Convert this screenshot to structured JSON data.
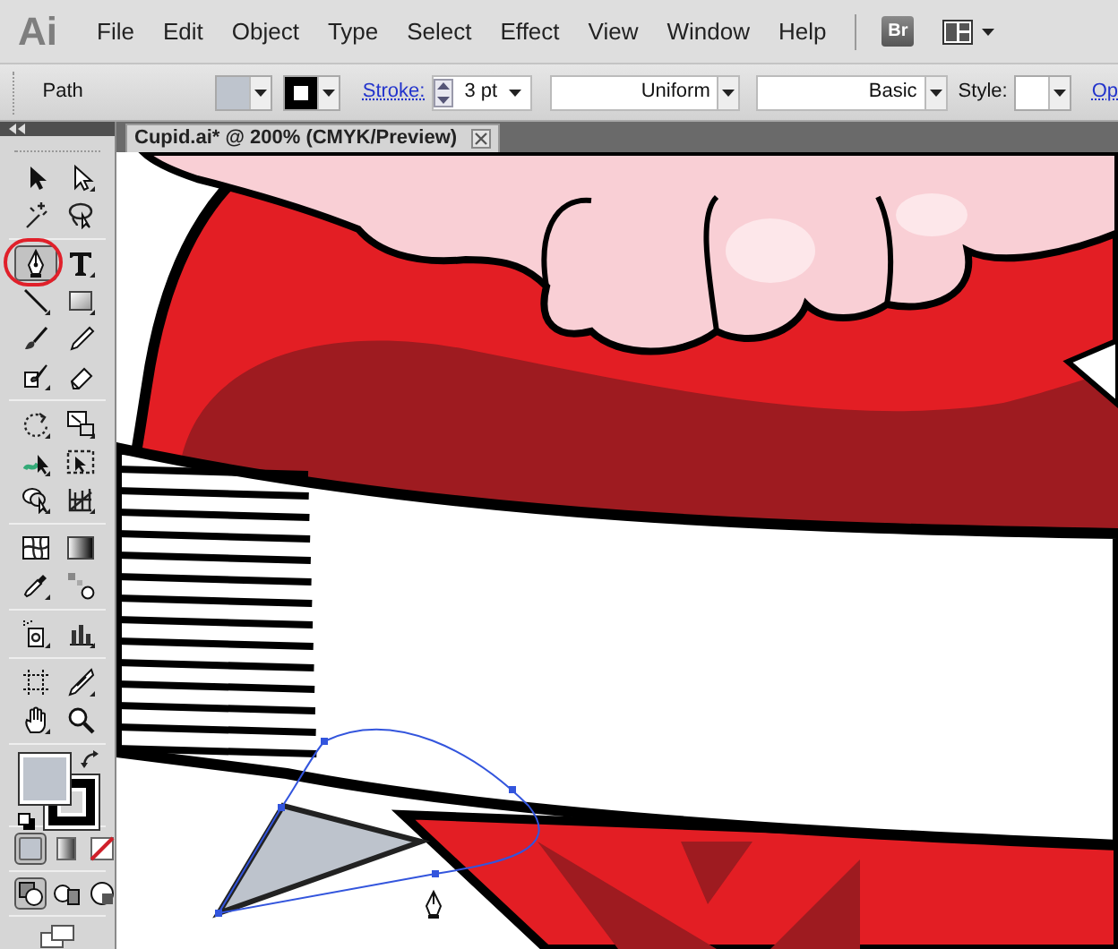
{
  "app": {
    "logo": "Ai",
    "menu": [
      "File",
      "Edit",
      "Object",
      "Type",
      "Select",
      "Effect",
      "View",
      "Window",
      "Help"
    ],
    "bridge_button": "Br"
  },
  "control_bar": {
    "selection_type": "Path",
    "stroke_label": "Stroke:",
    "stroke_weight": "3 pt",
    "width_profile": "Uniform",
    "brush": "Basic",
    "style_label": "Style:",
    "opacity_link": "Op"
  },
  "document_tab": {
    "title": "Cupid.ai* @ 200% (CMYK/Preview)"
  },
  "toolbox": {
    "groups": [
      [
        {
          "kind": "selection",
          "selected": false,
          "circled": false
        },
        {
          "kind": "direct-selection",
          "selected": false,
          "circled": false
        },
        {
          "kind": "magic-wand",
          "selected": false,
          "circled": false
        },
        {
          "kind": "lasso",
          "selected": false,
          "circled": false
        }
      ],
      [
        {
          "kind": "pen",
          "selected": true,
          "circled": true
        },
        {
          "kind": "type",
          "selected": false,
          "circled": false
        },
        {
          "kind": "line",
          "selected": false,
          "circled": false
        },
        {
          "kind": "rectangle",
          "selected": false,
          "circled": false
        },
        {
          "kind": "paintbrush",
          "selected": false,
          "circled": false
        },
        {
          "kind": "pencil",
          "selected": false,
          "circled": false
        },
        {
          "kind": "blob-brush",
          "selected": false,
          "circled": false
        },
        {
          "kind": "eraser",
          "selected": false,
          "circled": false
        }
      ],
      [
        {
          "kind": "rotate",
          "selected": false,
          "circled": false
        },
        {
          "kind": "scale",
          "selected": false,
          "circled": false
        },
        {
          "kind": "warp",
          "selected": false,
          "circled": false
        },
        {
          "kind": "free-transform",
          "selected": false,
          "circled": false
        },
        {
          "kind": "shape-builder",
          "selected": false,
          "circled": false
        },
        {
          "kind": "perspective-grid",
          "selected": false,
          "circled": false
        }
      ],
      [
        {
          "kind": "mesh",
          "selected": false,
          "circled": false
        },
        {
          "kind": "gradient",
          "selected": false,
          "circled": false
        },
        {
          "kind": "eyedropper",
          "selected": false,
          "circled": false
        },
        {
          "kind": "blend",
          "selected": false,
          "circled": false
        }
      ],
      [
        {
          "kind": "symbol-sprayer",
          "selected": false,
          "circled": false
        },
        {
          "kind": "column-graph",
          "selected": false,
          "circled": false
        }
      ],
      [
        {
          "kind": "artboard",
          "selected": false,
          "circled": false
        },
        {
          "kind": "slice",
          "selected": false,
          "circled": false
        },
        {
          "kind": "hand",
          "selected": false,
          "circled": false
        },
        {
          "kind": "zoom",
          "selected": false,
          "circled": false
        }
      ]
    ],
    "color_modes": [
      {
        "kind": "color",
        "selected": true
      },
      {
        "kind": "gradient",
        "selected": false
      },
      {
        "kind": "none",
        "selected": false
      }
    ],
    "draw_modes": [
      {
        "kind": "normal",
        "selected": true
      },
      {
        "kind": "behind",
        "selected": false
      },
      {
        "kind": "inside",
        "selected": false
      }
    ]
  }
}
